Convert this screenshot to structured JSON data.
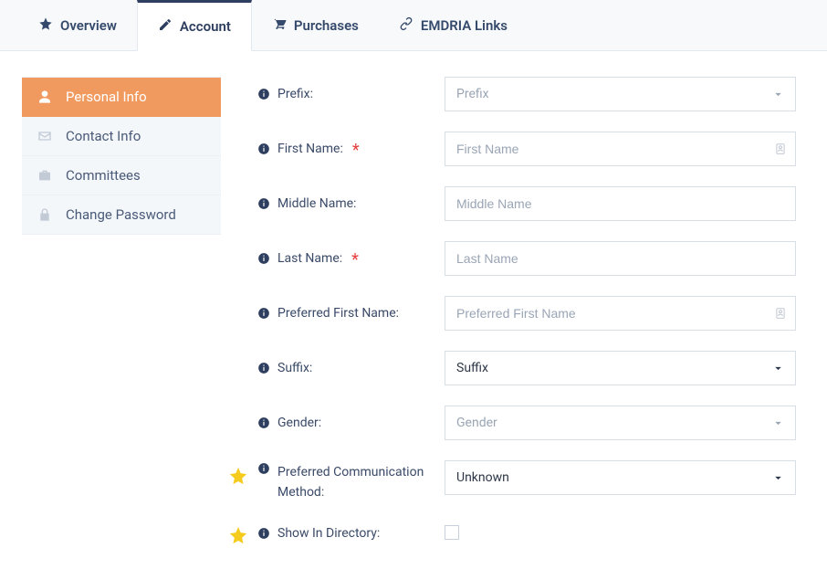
{
  "tabs": [
    {
      "label": "Overview"
    },
    {
      "label": "Account"
    },
    {
      "label": "Purchases"
    },
    {
      "label": "EMDRIA Links"
    }
  ],
  "active_tab_index": 1,
  "sidebar": {
    "items": [
      {
        "label": "Personal Info"
      },
      {
        "label": "Contact Info"
      },
      {
        "label": "Committees"
      },
      {
        "label": "Change Password"
      }
    ],
    "active_index": 0
  },
  "form": {
    "prefix": {
      "label": "Prefix:",
      "selected": "Prefix",
      "placeholder": true
    },
    "first_name": {
      "label": "First Name:",
      "placeholder": "First Name",
      "value": "",
      "required": true
    },
    "middle_name": {
      "label": "Middle Name:",
      "placeholder": "Middle Name",
      "value": ""
    },
    "last_name": {
      "label": "Last Name:",
      "placeholder": "Last Name",
      "value": "",
      "required": true
    },
    "preferred_first_name": {
      "label": "Preferred First Name:",
      "placeholder": "Preferred First Name",
      "value": ""
    },
    "suffix": {
      "label": "Suffix:",
      "selected": "Suffix",
      "placeholder": false
    },
    "gender": {
      "label": "Gender:",
      "selected": "Gender",
      "placeholder": true
    },
    "preferred_comm": {
      "label": "Preferred Communication Method:",
      "selected": "Unknown",
      "starred": true
    },
    "show_directory": {
      "label": "Show In Directory:",
      "checked": false,
      "starred": true
    }
  }
}
